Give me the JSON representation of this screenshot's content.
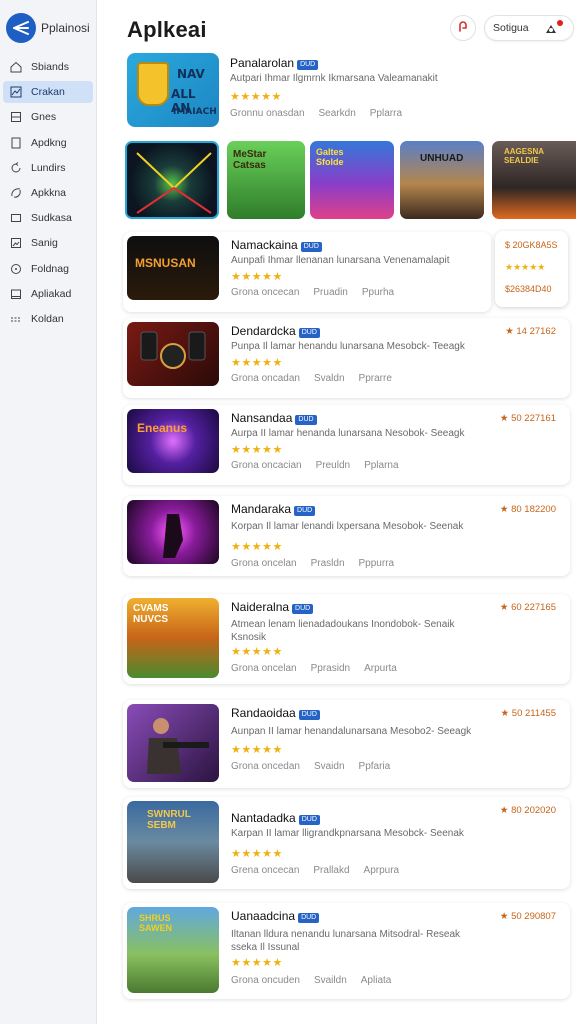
{
  "sidebar": {
    "brand": "Pplainosi",
    "items": [
      {
        "label": "Sbiands",
        "icon": "home-icon"
      },
      {
        "label": "Crakan",
        "icon": "chart-icon"
      },
      {
        "label": "Gnes",
        "icon": "layers-icon"
      },
      {
        "label": "Apdkng",
        "icon": "square-icon"
      },
      {
        "label": "Lundirs",
        "icon": "refresh-icon"
      },
      {
        "label": "Apkkna",
        "icon": "link-icon"
      },
      {
        "label": "Sudkasa",
        "icon": "box-icon"
      },
      {
        "label": "Sanig",
        "icon": "image-icon"
      },
      {
        "label": "Foldnag",
        "icon": "clock-icon"
      },
      {
        "label": "Apliakad",
        "icon": "calendar-icon"
      },
      {
        "label": "Koldan",
        "icon": "dots-icon"
      }
    ],
    "active_index": 1
  },
  "header": {
    "title": "Aplkeai",
    "pill_label": "Sotigua"
  },
  "featured": {
    "name": "Panalarolan",
    "tag": "DUD",
    "desc": "Autpari Ihmar Ilgmrnk Ikmarsana Valeamanakit",
    "stars": "★★★★★",
    "meta": [
      "Gronnu onasdan",
      "Searkdn",
      "Pplarra"
    ],
    "art_text": [
      "NAV",
      "ALL AN",
      "IMAIACH"
    ]
  },
  "apps": [
    {
      "name": "Namackaina",
      "tag": "DUD",
      "desc": "Aunpafi Ihmar llenanan lunarsana Venenamalapit",
      "stars": "★★★★★",
      "meta": [
        "Grona oncecan",
        "Pruadin",
        "Ppurha"
      ]
    },
    {
      "name": "Dendardcka",
      "tag": "DUD",
      "desc": "Punpa Il lamar henandu lunarsana Mesobck- Teeagk",
      "stars": "★★★★★",
      "rating": "★ 14 27162",
      "meta": [
        "Grona oncadan",
        "Svaldn",
        "Pprarre"
      ]
    },
    {
      "name": "Nansandaa",
      "tag": "DUD",
      "desc": "Aurpa II lamar henanda lunarsana Nesobok- Seeagk",
      "stars": "★★★★★",
      "rating": "★ 50 227161",
      "meta": [
        "Grona oncacian",
        "Preuldn",
        "Pplarna"
      ]
    },
    {
      "name": "Mandaraka",
      "tag": "DUD",
      "desc": "Korpan Il lamar lenandi lxpersana Mesobok- Seenak",
      "stars": "★★★★★",
      "rating": "★ 80 182200",
      "meta": [
        "Grona oncelan",
        "Prasldn",
        "Pppurra"
      ]
    },
    {
      "name": "Naideralna",
      "tag": "DUD",
      "desc": "Atmean lenam lienadadoukans Inondobok- Senaik",
      "desc2": "Ksnosik",
      "stars": "★★★★★",
      "rating": "★ 60 227165",
      "meta": [
        "Grona oncelan",
        "Pprasidn",
        "Arpurta"
      ]
    },
    {
      "name": "Randaoidaa",
      "tag": "DUD",
      "desc": "Aunpan II lamar henandalunarsana Mesobo2- Seeagk",
      "stars": "★★★★★",
      "rating": "★ 50 211455",
      "meta": [
        "Grona oncedan",
        "Svaidn",
        "Ppfaria"
      ]
    },
    {
      "name": "Nantadadka",
      "tag": "DUD",
      "desc": "Karpan II lamar lligrandkpnarsana Mesobck- Seenak",
      "stars": "★★★★★",
      "rating": "★ 80 202020",
      "meta": [
        "Grena oncecan",
        "Prallakd",
        "Aprpura"
      ]
    },
    {
      "name": "Uanaadcina",
      "tag": "DUD",
      "desc": "Iltanan lldura nenandu lunarsana Mitsodral- Reseak",
      "desc2": "sseka Il Issunal",
      "stars": "★★★★★",
      "rating": "★ 50 290807",
      "meta": [
        "Grona oncuden",
        "Svaildn",
        "Apliata"
      ]
    }
  ],
  "side_card": {
    "line1": "$ 20GK8A5S",
    "stars": "★★★★★",
    "line3": "$26384D40"
  },
  "thumb_texts": {
    "t0": "MSNUSAN",
    "t1": "Eneanus",
    "t2": "CVAMS\nNUVCS",
    "t3": "SWNRUL\nSEBM",
    "t4": "SHRUS\nSAWEN"
  },
  "shot_texts": [
    "",
    "MeStar\nCatsas",
    "Galtes\nSfolde",
    "UNHUAD",
    "AAGESNA\nSEALDIE"
  ],
  "colors": {
    "accent": "#1f5fc4",
    "active_bg": "#cfe0f7",
    "star": "#f0b010",
    "rating": "#c86418",
    "tag": "#2663c7"
  }
}
